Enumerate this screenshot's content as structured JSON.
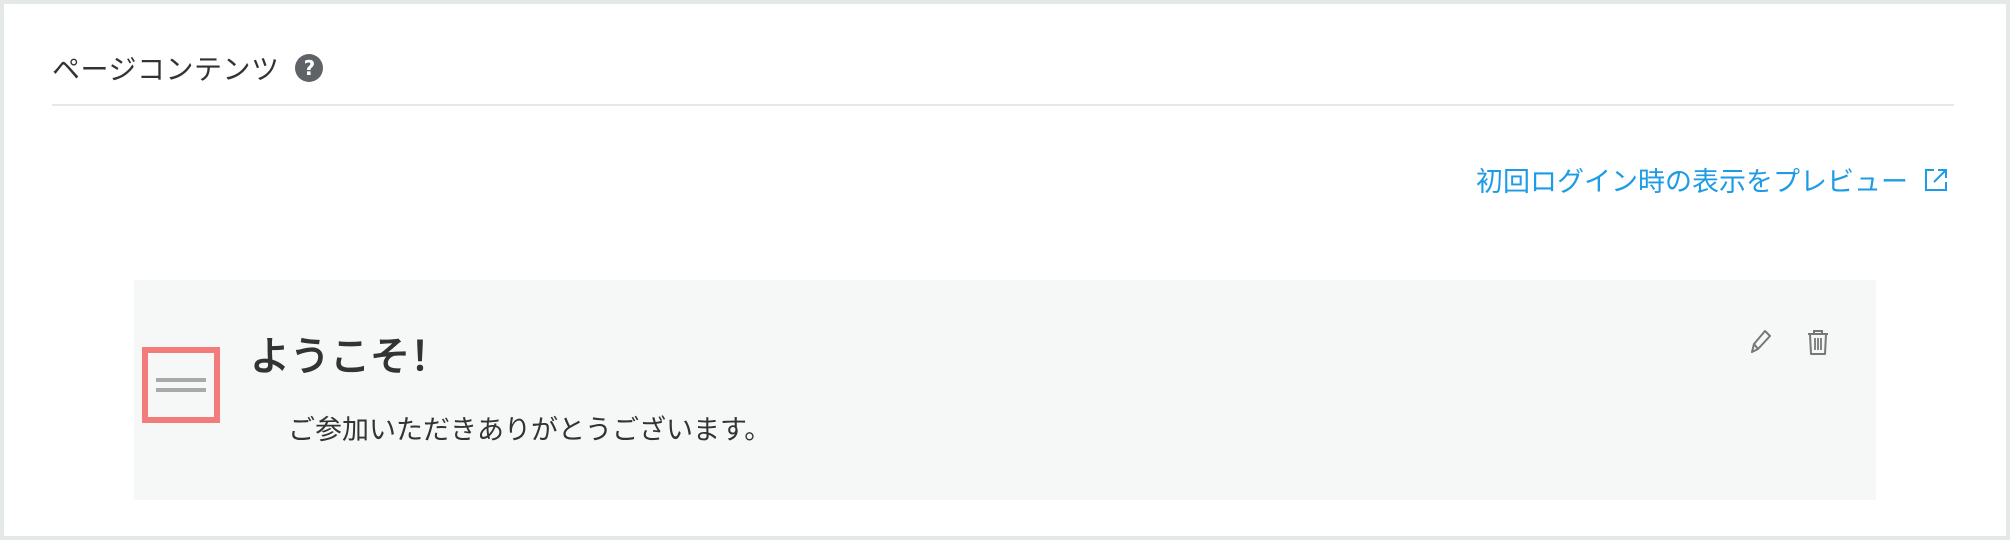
{
  "section": {
    "title": "ページコンテンツ",
    "help_icon": "question-circle-icon"
  },
  "preview_link": {
    "label": "初回ログイン時の表示をプレビュー",
    "icon": "external-link-icon"
  },
  "card": {
    "title": "ようこそ！",
    "body": "ご参加いただきありがとうございます。",
    "actions": {
      "edit_icon": "pencil-icon",
      "delete_icon": "trash-icon"
    },
    "drag_handle_icon": "drag-handle-icon",
    "highlight_color": "#f27b7b"
  },
  "colors": {
    "link": "#1e9be6",
    "text": "#333333",
    "card_bg": "#f6f8f8"
  }
}
